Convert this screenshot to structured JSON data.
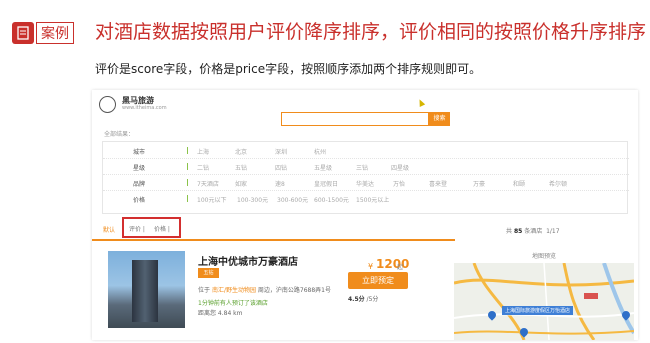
{
  "slide": {
    "tag": "案例",
    "title": "对酒店数据按照用户评价降序排序，评价相同的按照价格升序排序",
    "subtitle": "评价是score字段，价格是price字段，按照顺序添加两个排序规则即可。"
  },
  "site": {
    "name": "黑马旅游",
    "url": "www.itheima.com",
    "search_button": "搜索",
    "all_results": "全部结果："
  },
  "filters": [
    {
      "label": "城市",
      "options": [
        "上海",
        "北京",
        "深圳",
        "杭州"
      ]
    },
    {
      "label": "星级",
      "options": [
        "二钻",
        "五钻",
        "四钻",
        "五星级",
        "三钻",
        "四星级"
      ]
    },
    {
      "label": "品牌",
      "options": [
        "7天酒店",
        "如家",
        "速8",
        "皇冠假日",
        "华美达",
        "万怡",
        "喜来登",
        "万豪",
        "和颐",
        "希尔顿"
      ]
    },
    {
      "label": "价格",
      "options": [
        "100元以下",
        "100-300元",
        "300-600元",
        "600-1500元",
        "1500元以上"
      ]
    }
  ],
  "sort": {
    "default": "默认",
    "rating": "评价 |",
    "price": "价格 |"
  },
  "results": {
    "prefix": "共",
    "count": "85",
    "suffix": "条酒店",
    "page": "1/17"
  },
  "hotel": {
    "name": "上海中优城市万豪酒店",
    "stars": "五钻",
    "addr_prefix": "位于",
    "addr_highlight": "南汇/野生动物园",
    "addr_rest": "周边，沪南公路7688弄1号",
    "recent": "1分钟前有人预订了该酒店",
    "distance": "距离您 4.84 km",
    "price_symbol": "¥",
    "price": "1200",
    "price_suffix": "起",
    "book_button": "立即预定",
    "score": "4.5分",
    "score_suffix": " /5分"
  },
  "map": {
    "title": "地图预览",
    "label": "上海国际旅游度假区万怡酒店"
  },
  "colors": {
    "accent_red": "#c9302c",
    "orange": "#f08c1c",
    "highlight_box": "#d32f2f"
  }
}
